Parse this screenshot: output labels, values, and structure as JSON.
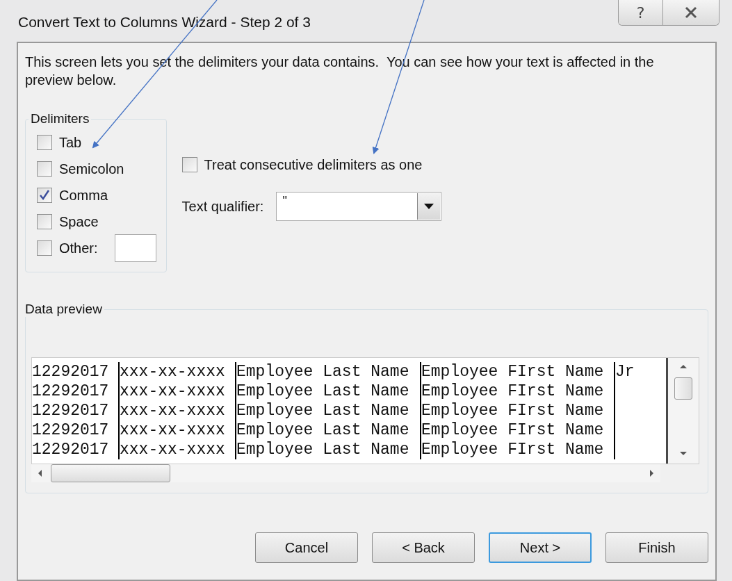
{
  "window": {
    "title": "Convert Text to Columns Wizard - Step 2 of 3",
    "help_button": "?"
  },
  "intro": "This screen lets you set the delimiters your data contains.  You can see how your text is affected in the preview below.",
  "delimiters": {
    "title": "Delimiters",
    "options": [
      {
        "label": "Tab",
        "checked": false
      },
      {
        "label": "Semicolon",
        "checked": false
      },
      {
        "label": "Comma",
        "checked": true
      },
      {
        "label": "Space",
        "checked": false
      },
      {
        "label": "Other:",
        "checked": false,
        "kind": "other"
      }
    ]
  },
  "consecutive": {
    "label": "Treat consecutive delimiters as one",
    "checked": false
  },
  "text_qualifier": {
    "label": "Text qualifier:",
    "value": "\""
  },
  "preview": {
    "title": "Data preview",
    "rows": [
      [
        "12292017",
        "xxx-xx-xxxx",
        "Employee Last Name",
        "Employee FIrst Name",
        "Jr"
      ],
      [
        "12292017",
        "xxx-xx-xxxx",
        "Employee Last Name",
        "Employee FIrst Name"
      ],
      [
        "12292017",
        "xxx-xx-xxxx",
        "Employee Last Name",
        "Employee FIrst Name"
      ],
      [
        "12292017",
        "xxx-xx-xxxx",
        "Employee Last Name",
        "Employee FIrst Name"
      ],
      [
        "12292017",
        "xxx-xx-xxxx",
        "Employee Last Name",
        "Employee FIrst Name"
      ]
    ]
  },
  "buttons": [
    {
      "label": "Cancel",
      "default": false
    },
    {
      "label": "< Back",
      "default": false
    },
    {
      "label": "Next >",
      "default": true
    },
    {
      "label": "Finish",
      "default": false
    }
  ]
}
